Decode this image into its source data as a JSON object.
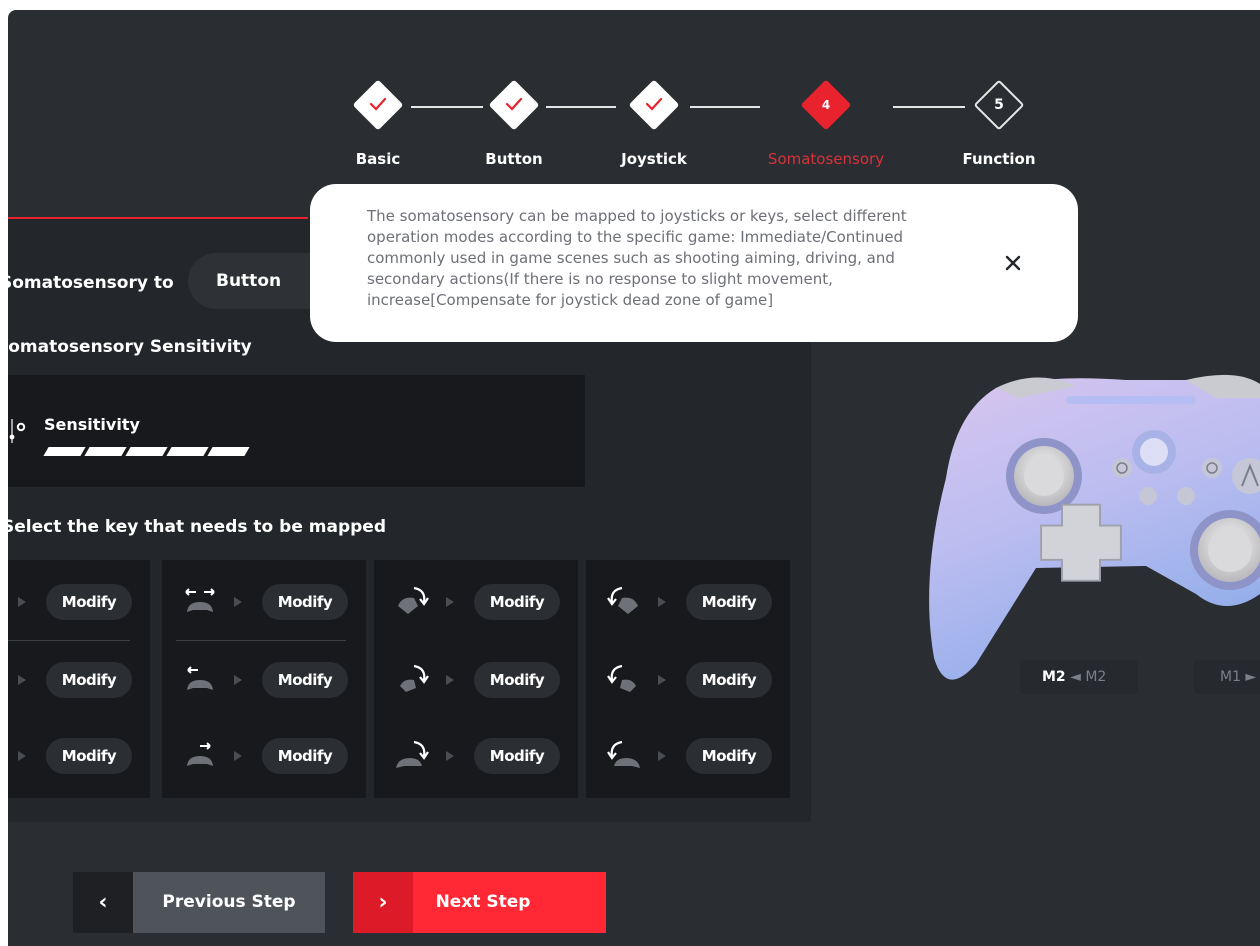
{
  "colors": {
    "accent": "#e8232d",
    "panel": "#23262b",
    "background": "#2a2d32",
    "tooltip_text": "#6e7077"
  },
  "stepper": {
    "steps": [
      {
        "label": "Basic",
        "status": "done"
      },
      {
        "label": "Button",
        "status": "done"
      },
      {
        "label": "Joystick",
        "status": "done"
      },
      {
        "label": "Somatosensory",
        "status": "active",
        "number": "4"
      },
      {
        "label": "Function",
        "status": "todo",
        "number": "5"
      }
    ]
  },
  "settings": {
    "map_label": "Somatosensory to",
    "map_value": "Button",
    "sensitivity_title": "Somatosensory Sensitivity",
    "sensitivity_label": "Sensitivity",
    "sensitivity_level": "5 of 5 bars filled",
    "key_title": "Select the key that needs to be mapped"
  },
  "mapping": {
    "modify_label": "Modify",
    "groups": [
      {
        "icons": [
          "",
          "",
          ""
        ]
      },
      {
        "icons": [
          "tilt-horizontal-icon",
          "tilt-left-icon",
          "tilt-right-icon"
        ]
      },
      {
        "icons": [
          "rotate-clockwise-icon",
          "rotate-clockwise-icon",
          "rotate-clockwise-icon"
        ]
      },
      {
        "icons": [
          "rotate-counterclockwise-icon",
          "rotate-counterclockwise-icon",
          "rotate-counterclockwise-icon"
        ]
      }
    ]
  },
  "controller": {
    "m2_tag": "M2",
    "m2_dim": "◄ M2",
    "m1_dim": "M1 ►"
  },
  "tooltip": {
    "text": "The somatosensory can be mapped to joysticks or keys, select different operation modes according to the specific game: Immediate/Continued commonly used in game scenes such as shooting aiming, driving, and secondary actions(If there is no response to slight movement, increase[Compensate for joystick dead zone of game]"
  },
  "buttons": {
    "prev_arrow": "‹",
    "prev_label": "Previous Step",
    "next_arrow": "›",
    "next_label": "Next Step"
  }
}
